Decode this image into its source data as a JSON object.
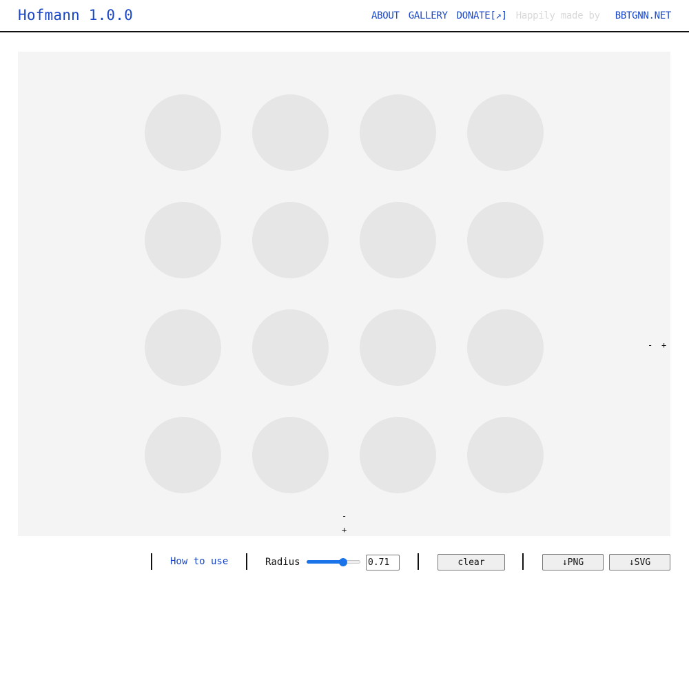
{
  "header": {
    "title": "Hofmann 1.0.0",
    "nav": {
      "about": "ABOUT",
      "gallery": "GALLERY",
      "donate": "DONATE[↗]",
      "made_by": "Happily made by",
      "credit": "BBTGNN.NET"
    }
  },
  "canvas": {
    "grid": {
      "rows": 4,
      "columns": 4
    },
    "colors": {
      "background": "#f4f4f4",
      "dot": "#e6e6e6"
    },
    "column_controls": {
      "minus": "-",
      "plus": "+"
    },
    "row_controls": {
      "minus": "-",
      "plus": "+"
    }
  },
  "toolbar": {
    "how_to_use": "How to use",
    "radius_label": "Radius",
    "radius_value": "0.71",
    "clear": "clear",
    "png": "↓PNG",
    "svg": "↓SVG"
  },
  "colors": {
    "accent": "#1947c7",
    "slider": "#1a73e8",
    "muted_text": "#d8d8d8"
  }
}
